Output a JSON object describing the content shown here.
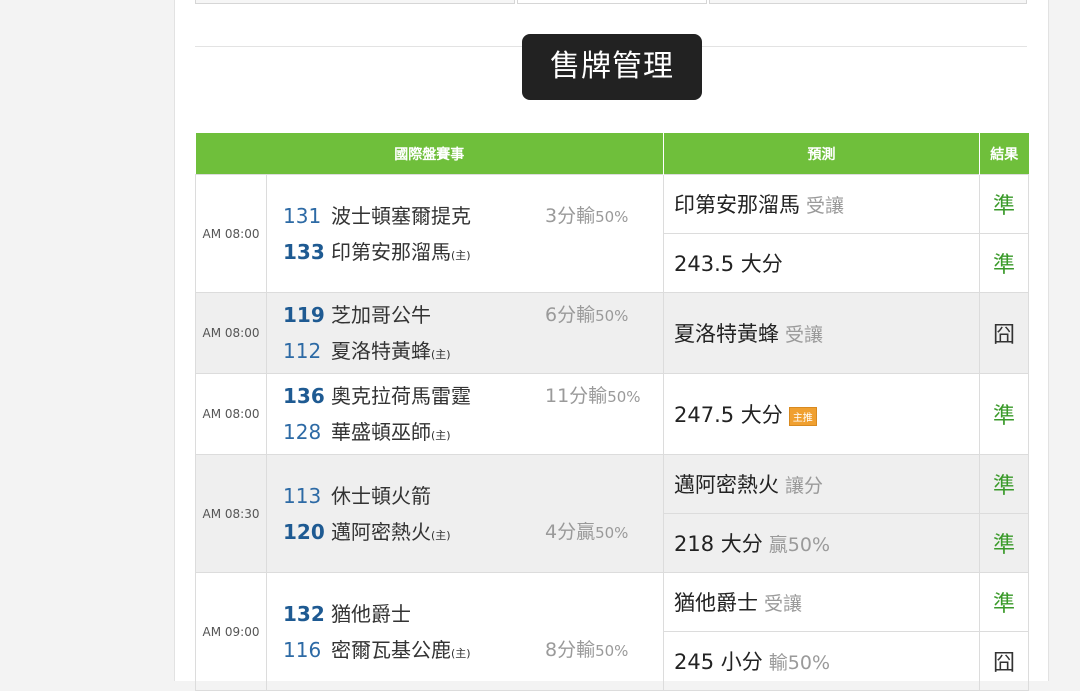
{
  "title": "售牌管理",
  "table": {
    "headers": [
      "國際盤賽事",
      "預測",
      "結果"
    ],
    "games": [
      {
        "time": "AM 08:00",
        "shade": false,
        "teams": [
          {
            "num": "131",
            "name": "波士頓塞爾提克",
            "host": ""
          },
          {
            "num": "133",
            "name": "印第安那溜馬",
            "host": "(主)"
          }
        ],
        "handicap_main": "3分輸",
        "handicap_pct": "50%",
        "handicap_row": 0,
        "predictions": [
          {
            "text": "印第安那溜馬",
            "sub": "受讓",
            "result": "準"
          },
          {
            "text": "243.5 大分",
            "sub": "",
            "result": "準"
          }
        ]
      },
      {
        "time": "AM 08:00",
        "shade": true,
        "teams": [
          {
            "num": "119",
            "name": "芝加哥公牛",
            "host": ""
          },
          {
            "num": "112",
            "name": "夏洛特黃蜂",
            "host": "(主)"
          }
        ],
        "handicap_main": "6分輸",
        "handicap_pct": "50%",
        "handicap_row": 0,
        "predictions": [
          {
            "text": "夏洛特黃蜂",
            "sub": "受讓",
            "result": "囧"
          }
        ]
      },
      {
        "time": "AM 08:00",
        "shade": false,
        "teams": [
          {
            "num": "136",
            "name": "奧克拉荷馬雷霆",
            "host": ""
          },
          {
            "num": "128",
            "name": "華盛頓巫師",
            "host": "(主)"
          }
        ],
        "handicap_main": "11分輸",
        "handicap_pct": "50%",
        "handicap_row": 0,
        "predictions": [
          {
            "text": "247.5 大分",
            "sub": "",
            "badge": "主推",
            "result": "準"
          }
        ]
      },
      {
        "time": "AM 08:30",
        "shade": true,
        "teams": [
          {
            "num": "113",
            "name": "休士頓火箭",
            "host": ""
          },
          {
            "num": "120",
            "name": "邁阿密熱火",
            "host": "(主)"
          }
        ],
        "handicap_main": "4分贏",
        "handicap_pct": "50%",
        "handicap_row": 1,
        "predictions": [
          {
            "text": "邁阿密熱火",
            "sub": "讓分",
            "result": "準"
          },
          {
            "text": "218 大分",
            "sub": "贏50%",
            "result": "準"
          }
        ]
      },
      {
        "time": "AM 09:00",
        "shade": false,
        "teams": [
          {
            "num": "132",
            "name": "猶他爵士",
            "host": ""
          },
          {
            "num": "116",
            "name": "密爾瓦基公鹿",
            "host": "(主)"
          }
        ],
        "handicap_main": "8分輸",
        "handicap_pct": "50%",
        "handicap_row": 1,
        "predictions": [
          {
            "text": "猶他爵士",
            "sub": "受讓",
            "result": "準"
          },
          {
            "text": "245 小分",
            "sub": "輸50%",
            "result": "囧"
          }
        ]
      }
    ]
  }
}
